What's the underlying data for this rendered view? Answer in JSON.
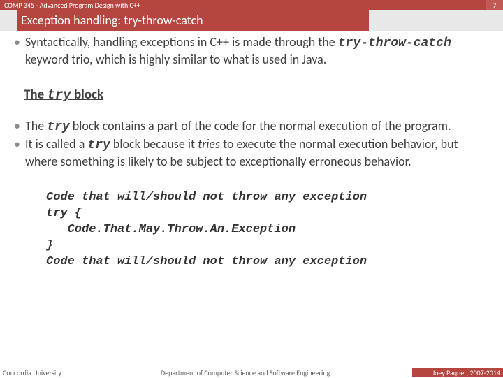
{
  "header": {
    "course": "COMP 345 - Advanced Program Design with C++",
    "slide_number": "7"
  },
  "title": "Exception handling: try-throw-catch",
  "bullets": {
    "b1_a": "Syntactically, handling exceptions in C++ is made through the ",
    "b1_kw": "try-throw-catch",
    "b1_b": " keyword trio, which is highly similar to what is used in Java.",
    "sec_a": "The ",
    "sec_kw": "try",
    "sec_b": " block",
    "b2_a": "The ",
    "b2_kw": "try",
    "b2_b": " block contains a part of the code for the normal execution of the program.",
    "b3_a": "It is called a ",
    "b3_kw": "try",
    "b3_b": " block because it ",
    "b3_it": "tries",
    "b3_c": " to execute the normal execution behavior, but where something is likely to be subject to exceptionally erroneous behavior."
  },
  "code": "Code that will/should not throw any exception\ntry {\n   Code.That.May.Throw.An.Exception\n}\nCode that will/should not throw any exception",
  "footer": {
    "left": "Concordia University",
    "mid": "Department of Computer Science and Software Engineering",
    "right": "Joey Paquet, 2007-2014"
  }
}
